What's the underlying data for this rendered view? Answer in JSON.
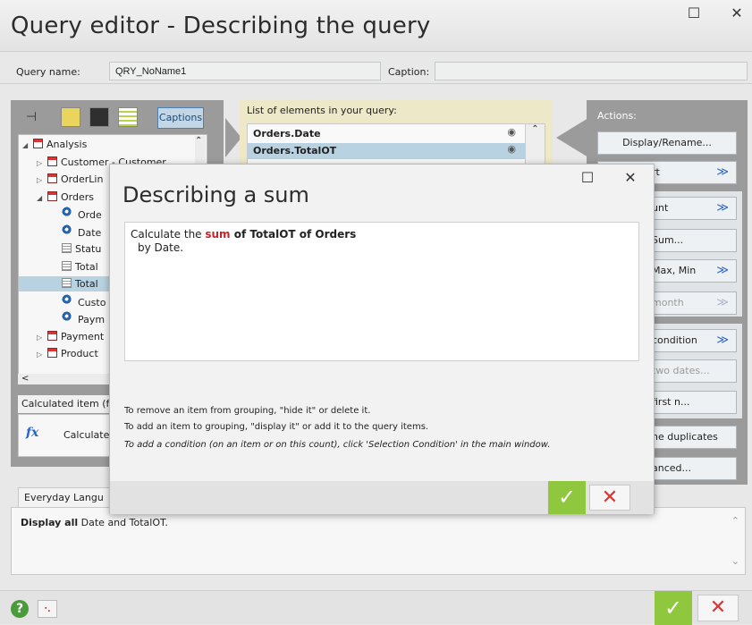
{
  "window": {
    "title": "Query editor - Describing the query",
    "minimize": "☐",
    "close": "✕"
  },
  "query_row": {
    "name_label": "Query name:",
    "name_value": "QRY_NoName1",
    "caption_label": "Caption:",
    "caption_value": ""
  },
  "left_panel": {
    "captions_button": "Captions",
    "tree": [
      {
        "label": "Analysis",
        "indent": 0,
        "icon": "analysis-icon",
        "expander": "◢"
      },
      {
        "label": "Customer  - Customer",
        "indent": 1,
        "icon": "table-icon",
        "expander": "▷"
      },
      {
        "label": "OrderLin",
        "indent": 1,
        "icon": "table-icon",
        "expander": "▷"
      },
      {
        "label": "Orders",
        "indent": 1,
        "icon": "table-icon",
        "expander": "◢"
      },
      {
        "label": "Orde",
        "indent": 2,
        "icon": "key-icon",
        "expander": ""
      },
      {
        "label": "Date",
        "indent": 2,
        "icon": "key-icon",
        "expander": ""
      },
      {
        "label": "Statu",
        "indent": 2,
        "icon": "field-icon",
        "expander": ""
      },
      {
        "label": "Total",
        "indent": 2,
        "icon": "field-icon",
        "expander": ""
      },
      {
        "label": "Total",
        "indent": 2,
        "icon": "field-icon",
        "expander": "",
        "selected": true
      },
      {
        "label": "Custo",
        "indent": 2,
        "icon": "key-icon",
        "expander": ""
      },
      {
        "label": "Paym",
        "indent": 2,
        "icon": "key-icon",
        "expander": ""
      },
      {
        "label": "Payment",
        "indent": 1,
        "icon": "table-icon",
        "expander": "▷"
      },
      {
        "label": "Product",
        "indent": 1,
        "icon": "table-icon",
        "expander": "▷"
      }
    ],
    "calc_label": "Calculated item (fo",
    "calc_item": "Calculate",
    "calc_icon_text": "fx"
  },
  "list_panel": {
    "title": "List of elements in your query:",
    "rows": [
      {
        "label": "Orders.Date",
        "selected": false
      },
      {
        "label": "Orders.TotalOT",
        "selected": true
      }
    ],
    "eye_glyph": "◉"
  },
  "actions": {
    "title": "Actions:",
    "items": [
      {
        "label": "Display/Rename...",
        "dim": false,
        "dbl": false
      },
      {
        "label": "rt",
        "dim": false,
        "dbl": true
      },
      {
        "label": "unt",
        "dim": false,
        "dbl": true
      },
      {
        "label": "Sum...",
        "dim": false,
        "dbl": false
      },
      {
        "label": "Max, Min",
        "dim": false,
        "dbl": true
      },
      {
        "label": "month",
        "dim": true,
        "dbl": true
      },
      {
        "label": "condition",
        "dim": false,
        "dbl": true
      },
      {
        "label": "two dates...",
        "dim": true,
        "dbl": false
      },
      {
        "label": "first n...",
        "dim": false,
        "dbl": false
      },
      {
        "label": "he duplicates",
        "dim": false,
        "dbl": false
      },
      {
        "label": "anced...",
        "dim": false,
        "dbl": false
      }
    ],
    "dbl_glyph": "≫"
  },
  "bottom": {
    "tab_label": "Everyday Langu",
    "desc_bold": "Display all",
    "desc_rest": " Date and TotalOT.",
    "help": "?",
    "ok": "✓",
    "cancel": "✕"
  },
  "dialog": {
    "title": "Describing a sum",
    "minimize": "☐",
    "close": "✕",
    "line1_prefix": "Calculate the ",
    "line1_sum": "sum",
    "line1_of": " of ",
    "line1_subject": "TotalOT of Orders",
    "line2": "by Date.",
    "note1": "To remove an item from grouping, \"hide it\" or delete it.",
    "note2": "To add an item to grouping, \"display it\" or add it to the query items.",
    "note3": "To add a condition (on an item or on this count), click 'Selection Condition' in the main window.",
    "ok": "✓",
    "cancel": "✕"
  }
}
